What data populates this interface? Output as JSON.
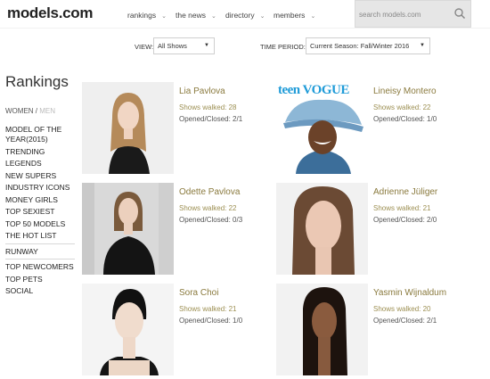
{
  "header": {
    "logo": "models.com",
    "nav": [
      {
        "label": "rankings"
      },
      {
        "label": "the news"
      },
      {
        "label": "directory"
      },
      {
        "label": "members"
      }
    ],
    "search_placeholder": "search models.com"
  },
  "filters": {
    "view_label": "VIEW:",
    "view_value": "All Shows",
    "period_label": "TIME PERIOD:",
    "period_value": "Current Season: Fall/Winter 2016"
  },
  "sidebar": {
    "title": "Rankings",
    "women": "WOMEN",
    "slash": " / ",
    "men": "MEN",
    "items": [
      "MODEL OF THE YEAR(2015)",
      "TRENDING",
      "LEGENDS",
      "NEW SUPERS",
      "INDUSTRY ICONS",
      "MONEY GIRLS",
      "TOP SEXIEST",
      "TOP 50 MODELS",
      "THE HOT LIST",
      "RUNWAY",
      "TOP NEWCOMERS",
      "TOP PETS",
      "SOCIAL"
    ]
  },
  "models": [
    {
      "name": "Lia Pavlova",
      "shows": "Shows walked: 28",
      "oc": "Opened/Closed: 2/1"
    },
    {
      "name": "Lineisy Montero",
      "shows": "Shows walked: 22",
      "oc": "Opened/Closed: 1/0",
      "magazine": "teen VOGUE"
    },
    {
      "name": "Odette Pavlova",
      "shows": "Shows walked: 22",
      "oc": "Opened/Closed: 0/3"
    },
    {
      "name": "Adrienne Jüliger",
      "shows": "Shows walked: 21",
      "oc": "Opened/Closed: 2/0"
    },
    {
      "name": "Sora Choi",
      "shows": "Shows walked: 21",
      "oc": "Opened/Closed: 1/0"
    },
    {
      "name": "Yasmin Wijnaldum",
      "shows": "Shows walked: 20",
      "oc": "Opened/Closed: 2/1"
    }
  ]
}
